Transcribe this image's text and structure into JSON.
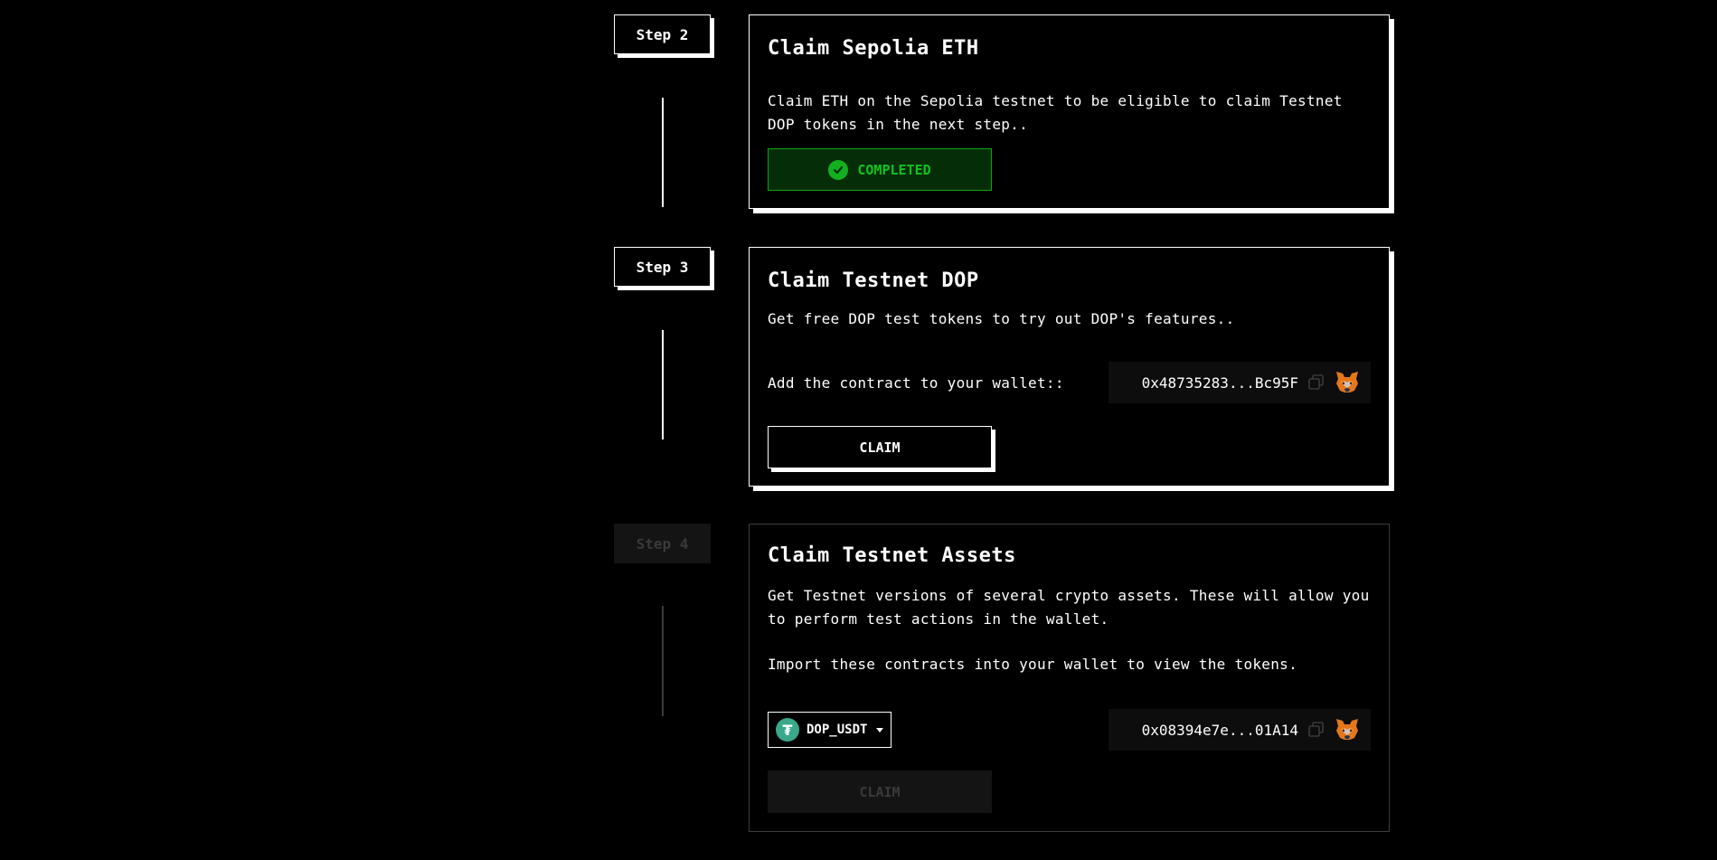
{
  "steps": [
    {
      "tag": "Step 2",
      "title": "Claim Sepolia ETH",
      "description": "Claim ETH on the Sepolia testnet to be eligible to claim Testnet DOP tokens in the next step..",
      "status": "COMPLETED"
    },
    {
      "tag": "Step 3",
      "title": "Claim Testnet DOP",
      "description": "Get free DOP test tokens to try out DOP's features..",
      "contract_label": "Add the contract to your wallet::",
      "address": "0x48735283...Bc95F",
      "button": "CLAIM"
    },
    {
      "tag": "Step 4",
      "title": "Claim Testnet Assets",
      "description": "Get Testnet versions of several crypto assets. These will allow you to perform test actions in the wallet.",
      "description2": "Import these contracts into your wallet to view the tokens.",
      "token": "DOP_USDT",
      "address": "0x08394e7e...01A14",
      "button": "CLAIM"
    }
  ],
  "colors": {
    "background": "#000000",
    "completed_green": "#12c21e",
    "disabled": "#3a3a3a",
    "tether": "#3aa88a",
    "metamask": "#e2761b"
  },
  "icons": {
    "check": "check-circle-icon",
    "copy": "copy-icon",
    "wallet": "metamask-fox-icon",
    "token": "tether-icon",
    "dropdown": "caret-down-icon"
  }
}
